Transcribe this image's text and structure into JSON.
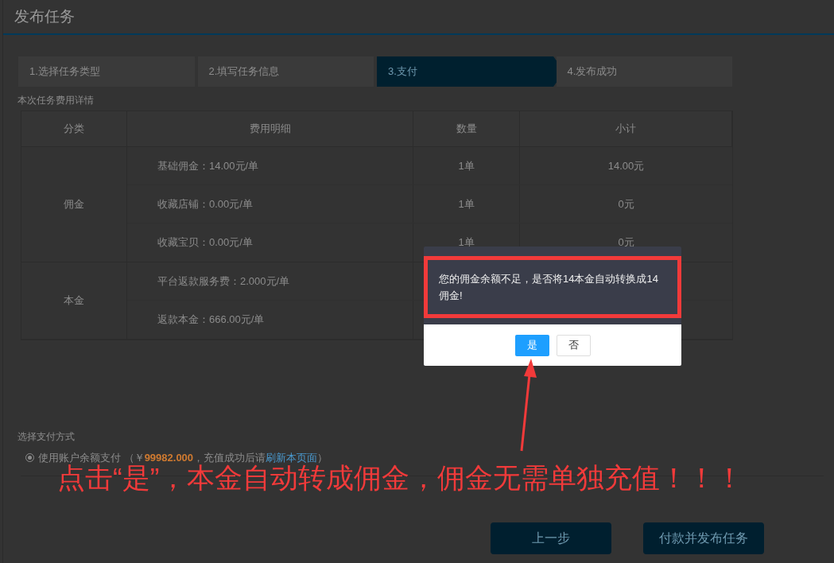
{
  "page": {
    "title": "发布任务"
  },
  "steps": [
    {
      "label": "1.选择任务类型",
      "selected": false
    },
    {
      "label": "2.填写任务信息",
      "selected": false
    },
    {
      "label": "3.支付",
      "selected": true
    },
    {
      "label": "4.发布成功",
      "selected": false
    }
  ],
  "fees": {
    "title": "本次任务费用详情",
    "columns": [
      "分类",
      "费用明细",
      "数量",
      "小计"
    ],
    "groups": [
      {
        "category": "佣金",
        "rows": [
          {
            "detail": "基础佣金：14.00元/单",
            "quantity": "1单",
            "subtotal": "14.00元"
          },
          {
            "detail": "收藏店铺：0.00元/单",
            "quantity": "1单",
            "subtotal": "0元"
          },
          {
            "detail": "收藏宝贝：0.00元/单",
            "quantity": "1单",
            "subtotal": "0元"
          }
        ]
      },
      {
        "category": "本金",
        "rows": [
          {
            "detail": "平台返款服务费：2.000元/单"
          },
          {
            "detail": "返款本金：666.00元/单"
          }
        ]
      }
    ]
  },
  "payment": {
    "title": "选择支付方式",
    "options": [
      {
        "selected": true,
        "label": "使用账户余额支付",
        "open": "（￥",
        "amount": "99982.000",
        "middle": "，充值成功后请",
        "link": "刷新本页面",
        "close": "）"
      }
    ]
  },
  "buttons": [
    {
      "label": "上一步"
    },
    {
      "label": "付款并发布任务"
    }
  ],
  "dialog": {
    "message": "您的佣金余额不足，是否将14本金自动转换成14佣金!",
    "buttons": [
      {
        "label": "是",
        "primary": true
      },
      {
        "label": "否",
        "primary": false
      }
    ]
  },
  "annotation": {
    "text": "点击“是”，本金自动转成佣金，佣金无需单独充值！！！"
  }
}
